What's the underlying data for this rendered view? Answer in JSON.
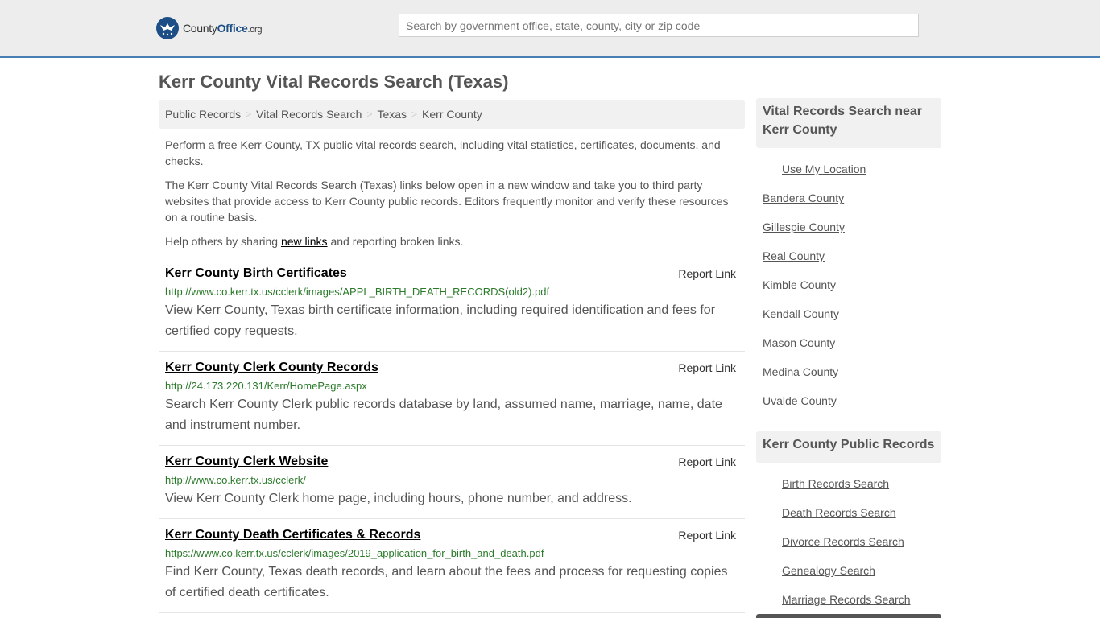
{
  "header": {
    "logo": {
      "brand_bold": "County",
      "brand_bold2": "Office",
      "brand_tld": ".org"
    },
    "search_placeholder": "Search by government office, state, county, city or zip code"
  },
  "page_title": "Kerr County Vital Records Search (Texas)",
  "breadcrumb": [
    "Public Records",
    "Vital Records Search",
    "Texas",
    "Kerr County"
  ],
  "intro": {
    "p1": "Perform a free Kerr County, TX public vital records search, including vital statistics, certificates, documents, and checks.",
    "p2": "The Kerr County Vital Records Search (Texas) links below open in a new window and take you to third party websites that provide access to Kerr County public records. Editors frequently monitor and verify these resources on a routine basis.",
    "p3_before": "Help others by sharing ",
    "p3_link": "new links",
    "p3_after": " and reporting broken links."
  },
  "report_label": "Report Link",
  "results": [
    {
      "title": "Kerr County Birth Certificates",
      "url": "http://www.co.kerr.tx.us/cclerk/images/APPL_BIRTH_DEATH_RECORDS(old2).pdf",
      "desc": "View Kerr County, Texas birth certificate information, including required identification and fees for certified copy requests."
    },
    {
      "title": "Kerr County Clerk County Records",
      "url": "http://24.173.220.131/Kerr/HomePage.aspx",
      "desc": "Search Kerr County Clerk public records database by land, assumed name, marriage, name, date and instrument number."
    },
    {
      "title": "Kerr County Clerk Website",
      "url": "http://www.co.kerr.tx.us/cclerk/",
      "desc": "View Kerr County Clerk home page, including hours, phone number, and address."
    },
    {
      "title": "Kerr County Death Certificates & Records",
      "url": "https://www.co.kerr.tx.us/cclerk/images/2019_application_for_birth_and_death.pdf",
      "desc": "Find Kerr County, Texas death records, and learn about the fees and process for requesting copies of certified death certificates."
    }
  ],
  "sidebar": {
    "nearby_title": "Vital Records Search near Kerr County",
    "use_location": "Use My Location",
    "nearby": [
      "Bandera County",
      "Gillespie County",
      "Real County",
      "Kimble County",
      "Kendall County",
      "Mason County",
      "Medina County",
      "Uvalde County"
    ],
    "public_title": "Kerr County Public Records",
    "public": [
      "Birth Records Search",
      "Death Records Search",
      "Divorce Records Search",
      "Genealogy Search",
      "Marriage Records Search"
    ]
  }
}
